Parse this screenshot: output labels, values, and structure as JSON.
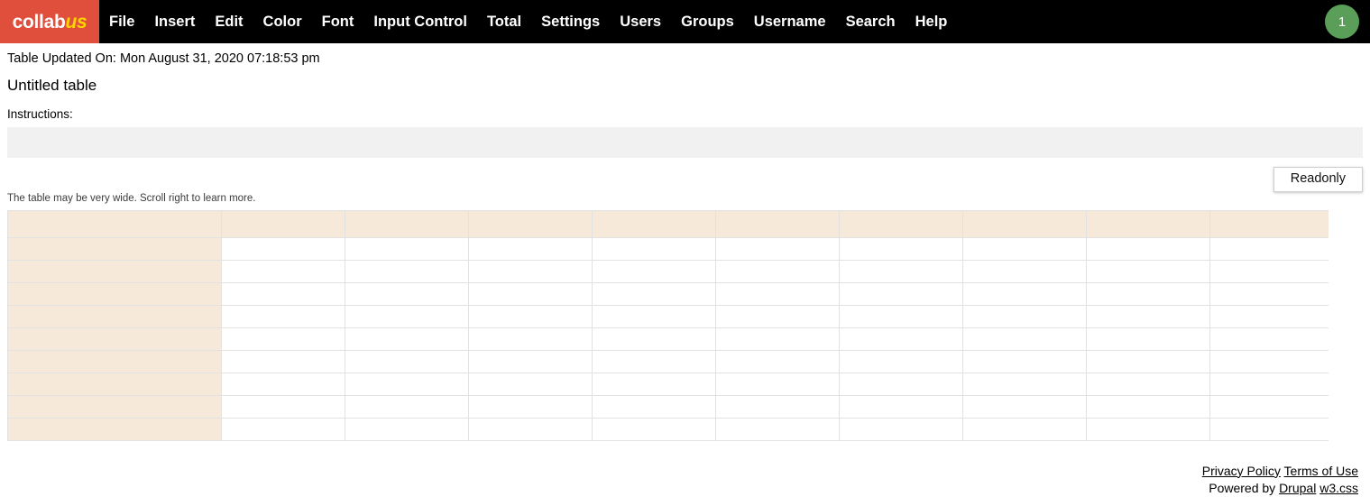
{
  "navbar": {
    "brand": {
      "part1": "collab",
      "part2": "us"
    },
    "items": [
      {
        "label": "File"
      },
      {
        "label": "Insert"
      },
      {
        "label": "Edit"
      },
      {
        "label": "Color"
      },
      {
        "label": "Font"
      },
      {
        "label": "Input Control"
      },
      {
        "label": "Total"
      },
      {
        "label": "Settings"
      },
      {
        "label": "Users"
      },
      {
        "label": "Groups"
      },
      {
        "label": "Username"
      },
      {
        "label": "Search"
      },
      {
        "label": "Help"
      }
    ],
    "badge": "1",
    "colors": {
      "brand_bg": "#e04e3c",
      "brand_accent": "#ffd400",
      "bar_bg": "#000000",
      "badge_bg": "#5a9e5a"
    }
  },
  "main": {
    "updated_line": "Table Updated On: Mon August 31, 2020 07:18:53 pm",
    "table_title": "Untitled table",
    "instructions_label": "Instructions:",
    "instructions_value": "",
    "instructions_placeholder": "",
    "readonly_button": "Readonly",
    "scroll_hint": "The table may be very wide. Scroll right to learn more."
  },
  "table": {
    "columns": [
      "",
      "",
      "",
      "",
      "",
      "",
      "",
      "",
      "",
      ""
    ],
    "rows": [
      [
        "",
        "",
        "",
        "",
        "",
        "",
        "",
        "",
        "",
        ""
      ],
      [
        "",
        "",
        "",
        "",
        "",
        "",
        "",
        "",
        "",
        ""
      ],
      [
        "",
        "",
        "",
        "",
        "",
        "",
        "",
        "",
        "",
        ""
      ],
      [
        "",
        "",
        "",
        "",
        "",
        "",
        "",
        "",
        "",
        ""
      ],
      [
        "",
        "",
        "",
        "",
        "",
        "",
        "",
        "",
        "",
        ""
      ],
      [
        "",
        "",
        "",
        "",
        "",
        "",
        "",
        "",
        "",
        ""
      ],
      [
        "",
        "",
        "",
        "",
        "",
        "",
        "",
        "",
        "",
        ""
      ],
      [
        "",
        "",
        "",
        "",
        "",
        "",
        "",
        "",
        "",
        ""
      ],
      [
        "",
        "",
        "",
        "",
        "",
        "",
        "",
        "",
        "",
        ""
      ]
    ],
    "colors": {
      "header_bg": "#f7e9da",
      "rowhead_bg": "#f7e9da",
      "cell_bg": "#ffffff",
      "border": "#e2e2e2"
    }
  },
  "footer": {
    "privacy_policy": "Privacy Policy",
    "terms_of_use": "Terms of Use",
    "powered_by": "Powered by",
    "drupal": "Drupal",
    "w3css": "w3.css"
  }
}
